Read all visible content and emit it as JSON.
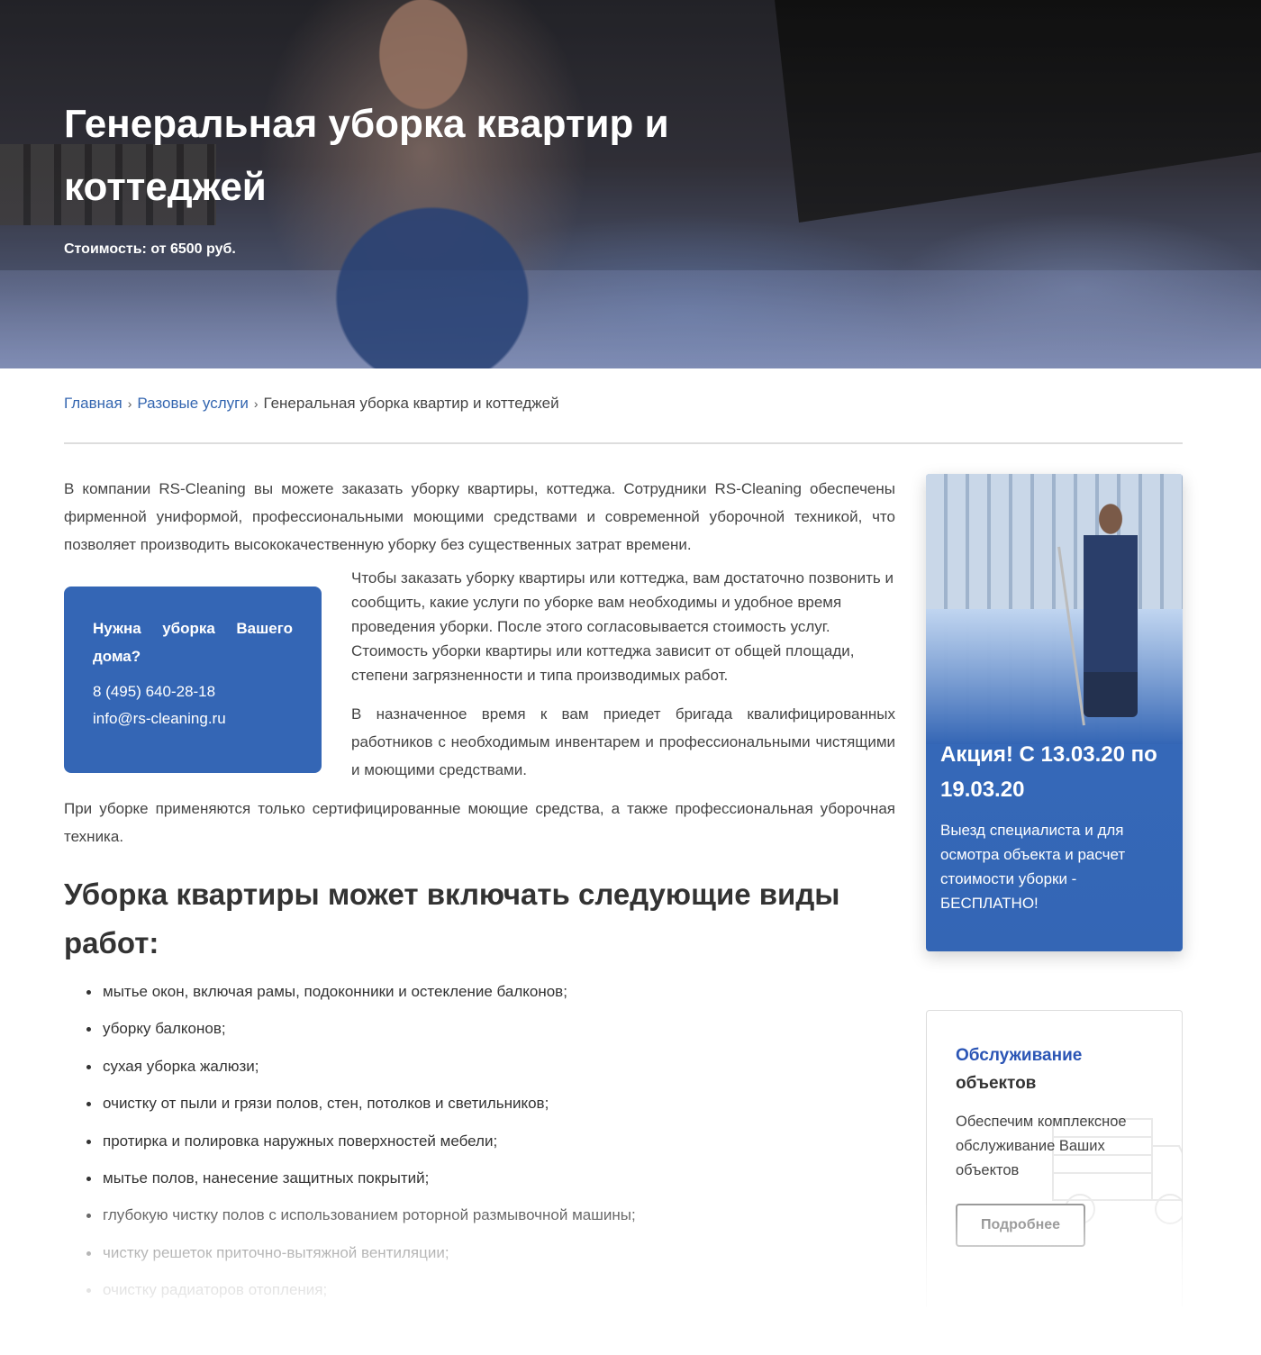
{
  "hero": {
    "title": "Генеральная уборка квартир и коттеджей",
    "price": "Стоимость: от 6500 руб."
  },
  "breadcrumb": {
    "home": "Главная",
    "section": "Разовые услуги",
    "separator": "›",
    "current": "Генеральная уборка квартир и коттеджей"
  },
  "content": {
    "intro": "В компании RS-Cleaning вы можете заказать уборку квартиры, коттеджа. Сотрудники RS-Cleaning обеспечены фирменной униформой, профессиональными моющими средствами и современной уборочной техникой, что позволяет производить высококачественную уборку без существенных затрат времени.",
    "order_text": "Чтобы заказать уборку квартиры или коттеджа, вам достаточно позвонить и сообщить, какие услуги по уборке вам необходимы и удобное время проведения уборки. После этого согласовывается стоимость услуг. Стоимость уборки квартиры или коттеджа зависит от общей площади, степени загрязненности и типа производимых работ.",
    "team_text": "В назначенное время к вам приедет бригада квалифицированных работников с необходимым инвентарем и профессиональными чистящими и моющими средствами.",
    "certified_text": "При уборке применяются только сертифицированные моющие средства, а также профессиональная уборочная техника.",
    "list_heading": "Уборка квартиры может включать следующие виды работ:",
    "list_items": [
      "мытье окон, включая рамы, подоконники и остекление балконов;",
      "уборку балконов;",
      "сухая уборка жалюзи;",
      "очистку от пыли и грязи полов, стен, потолков и светильников;",
      "протирка и полировка наружных поверхностей мебели;",
      "мытье полов, нанесение защитных покрытий;",
      "глубокую чистку полов с использованием роторной размывочной машины;",
      "чистку решеток приточно-вытяжной вентиляции;",
      "очистку радиаторов отопления;"
    ]
  },
  "contact_card": {
    "title_words": [
      "Нужна",
      "уборка",
      "Вашего",
      "дома?"
    ],
    "phone": "8 (495) 640-28-18",
    "email": "info@rs-cleaning.ru"
  },
  "promo": {
    "title": "Акция! С 13.03.20 по 19.03.20",
    "text": "Выезд специалиста и для осмотра объекта и расчет стоимости уборки - БЕСПЛАТНО!"
  },
  "service": {
    "title_accent": "Обслуживание",
    "title_rest": "объектов",
    "text": "Обеспечим комплексное обслуживание Ваших объектов",
    "button_label": "Подробнее",
    "icon": "truck-outline-icon"
  },
  "colors": {
    "accent_blue": "#3466b5",
    "link_blue": "#3466b0",
    "heading_blue": "#2b55b5",
    "text": "#444444"
  }
}
